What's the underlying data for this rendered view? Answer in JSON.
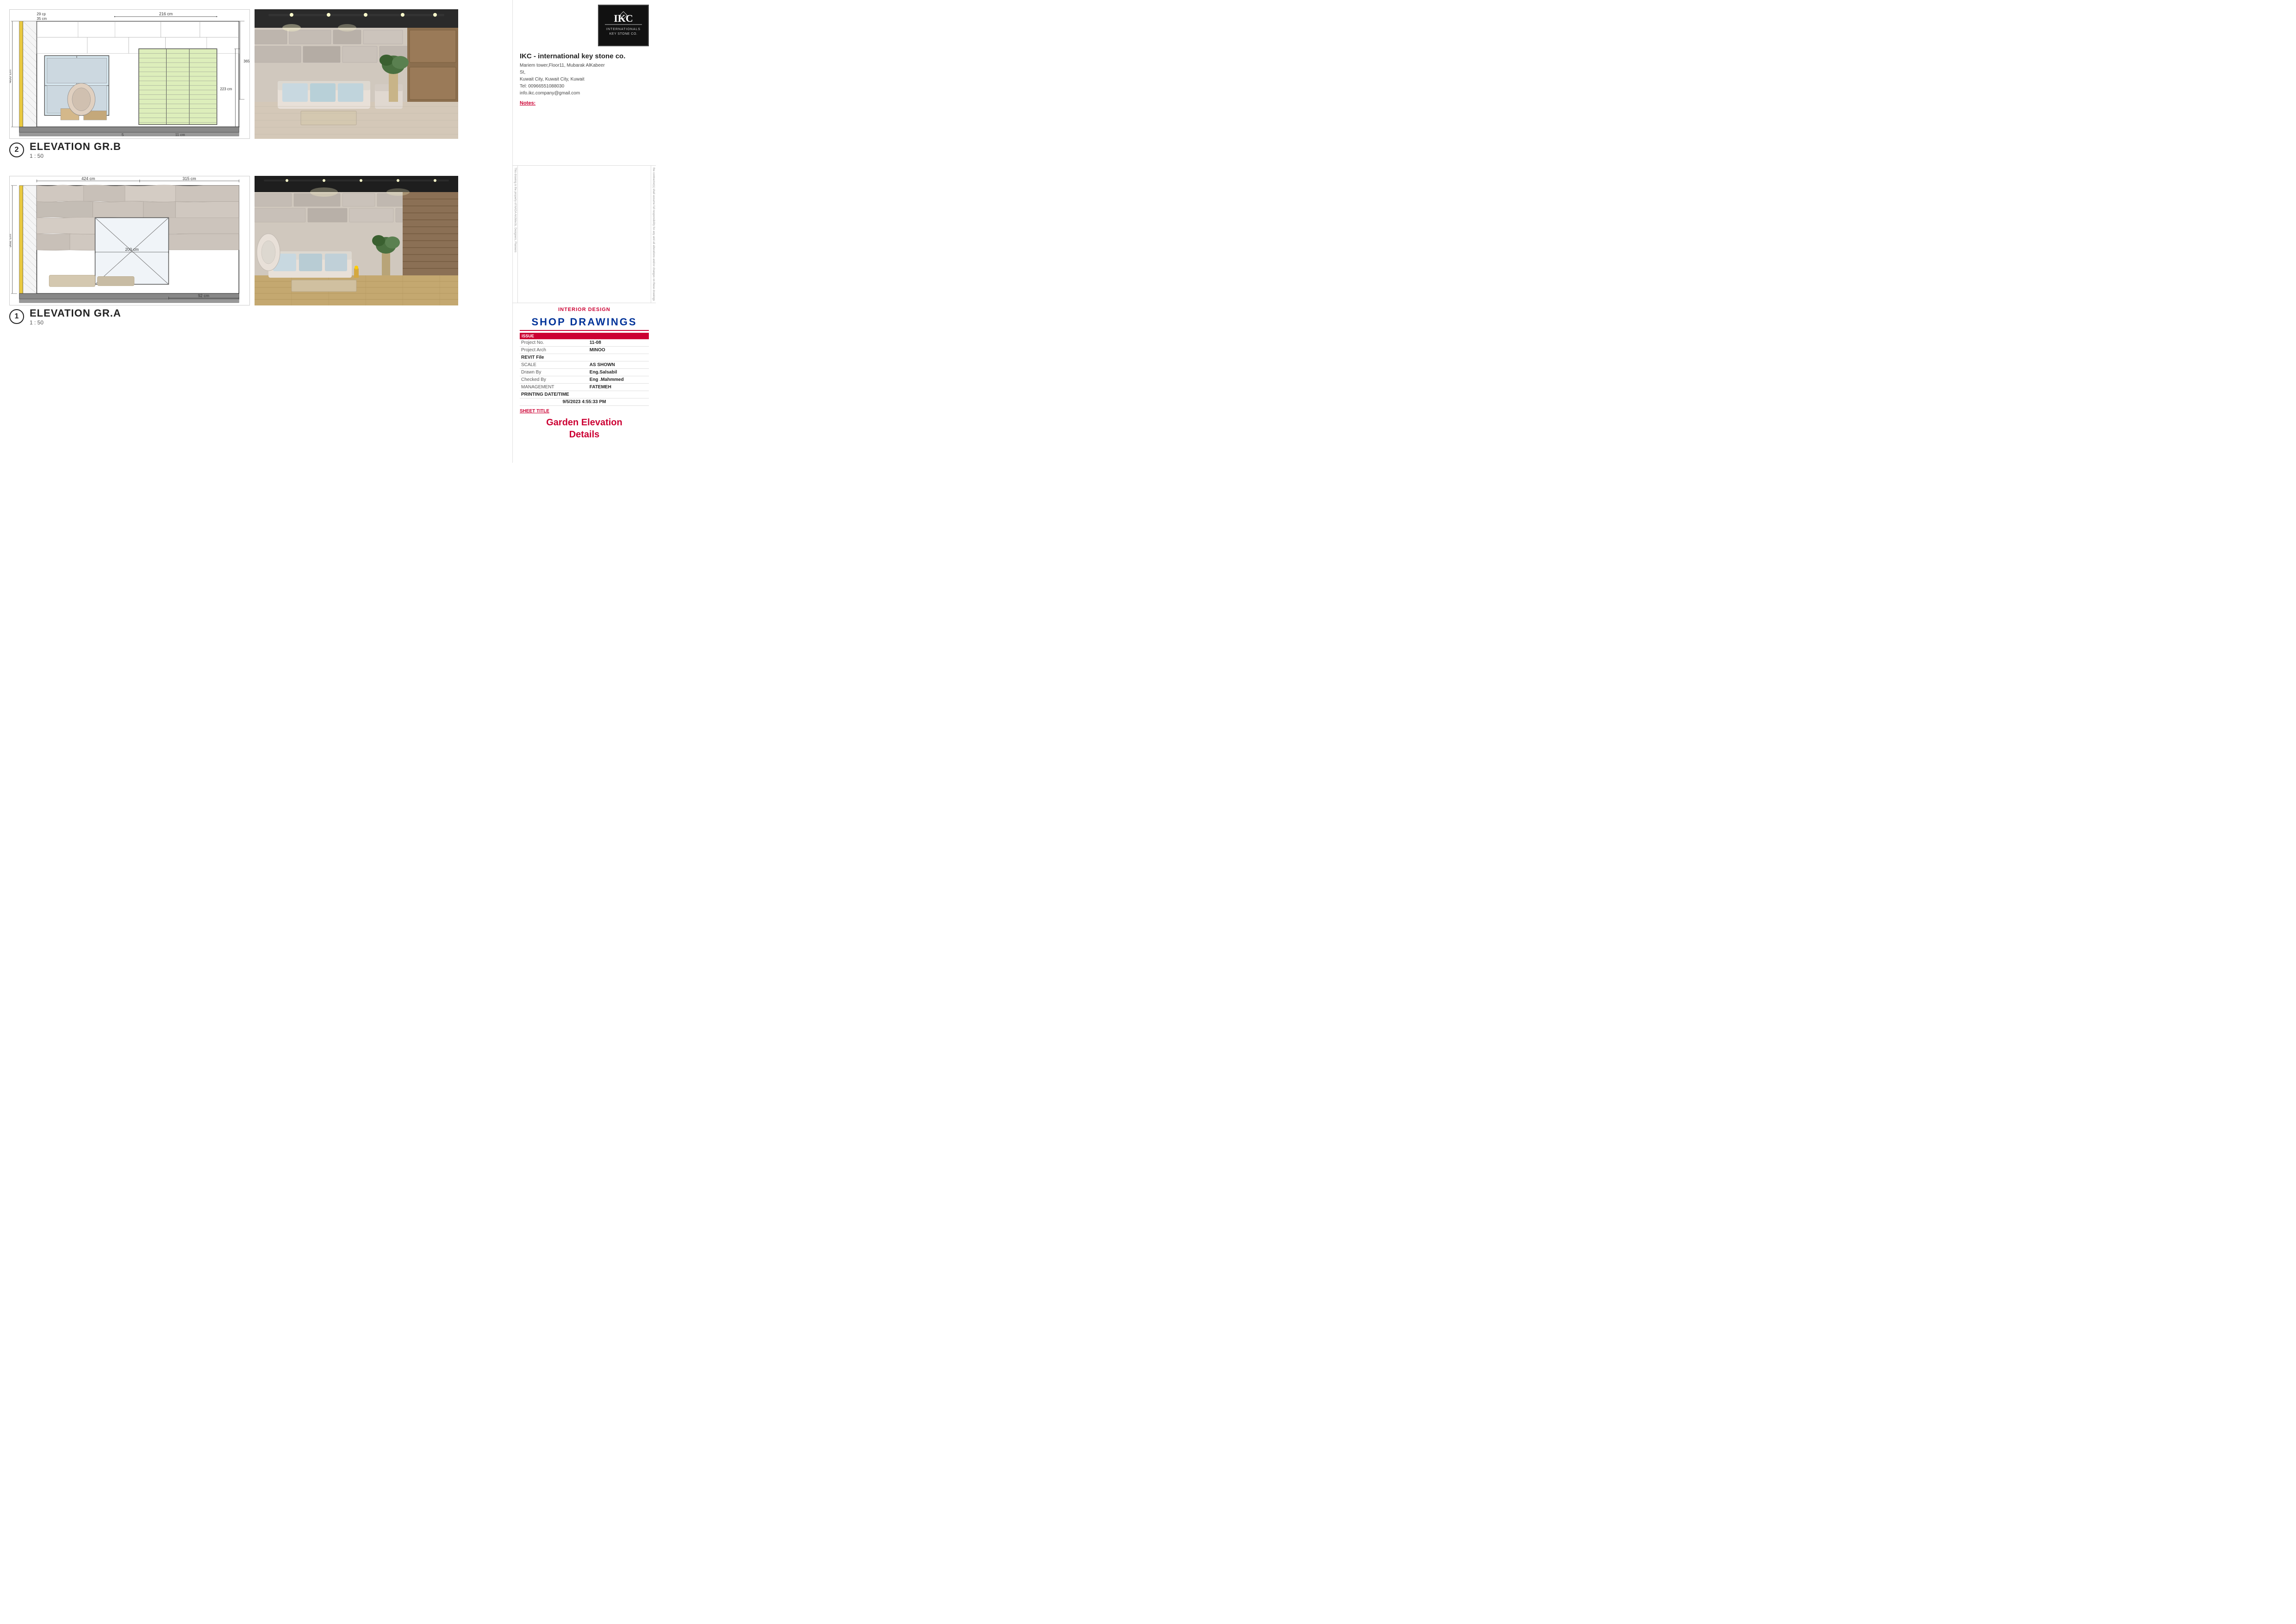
{
  "company": {
    "name": "IKC - international key stone co.",
    "address_line1": "Mariem tower,Floor11, Mubarak AlKabeer",
    "address_line2": "St,",
    "address_line3": "Kuwait City, Kuwait City, Kuwait",
    "tel": "Tel: 00966551088030",
    "email": "info.ikc.company@gmail.com"
  },
  "notes_label": "Notes:",
  "discipline": "INTERIOR DESIGN",
  "project_type": "SHOP  DRAWINGS",
  "issue_label": "ISSUE",
  "project_no_label": "Project No.",
  "project_no_value": "11-08",
  "project_arch_label": "Project Arch",
  "project_arch_value": "MINOO",
  "revit_file_label": "REVIT File",
  "scale_label": "SCALE",
  "scale_value": "AS SHOWN",
  "drawn_by_label": "Drawn By",
  "drawn_by_value": "Eng.Salsabil",
  "checked_by_label": "Checked By",
  "checked_by_value": "Eng .Mahmmed",
  "management_label": "MANAGEMENT",
  "management_value": "FATEMEH",
  "printing_label": "PRINTING DATE/TIME",
  "printing_value": "9/5/2023 4:55:33 PM",
  "sheet_title_label": "SHEET TITLE",
  "sheet_title_value": "Garden Elevation\nDetails",
  "elevation_b": {
    "number": "2",
    "title": "ELEVATION GR.B",
    "scale": "1 : 50",
    "dimensions": {
      "top_left": "29 cm",
      "width_left": "35 cm",
      "total_height": "400 cm",
      "top_span": "216 cm",
      "right_height1": "365 cm",
      "right_height2": "223 cm",
      "bottom_left": "5",
      "bottom_right": "11 cm"
    }
  },
  "elevation_a": {
    "number": "1",
    "title": "ELEVATION GR.A",
    "scale": "1 : 50",
    "dimensions": {
      "top_left": "424 cm",
      "top_right": "315 cm",
      "left_height": "382 cm",
      "center_height": "200 cm",
      "bottom_right": "92 cm"
    }
  },
  "logo": {
    "text": "IKC\nINTERNATIONALS\nKEY STONE CO."
  }
}
